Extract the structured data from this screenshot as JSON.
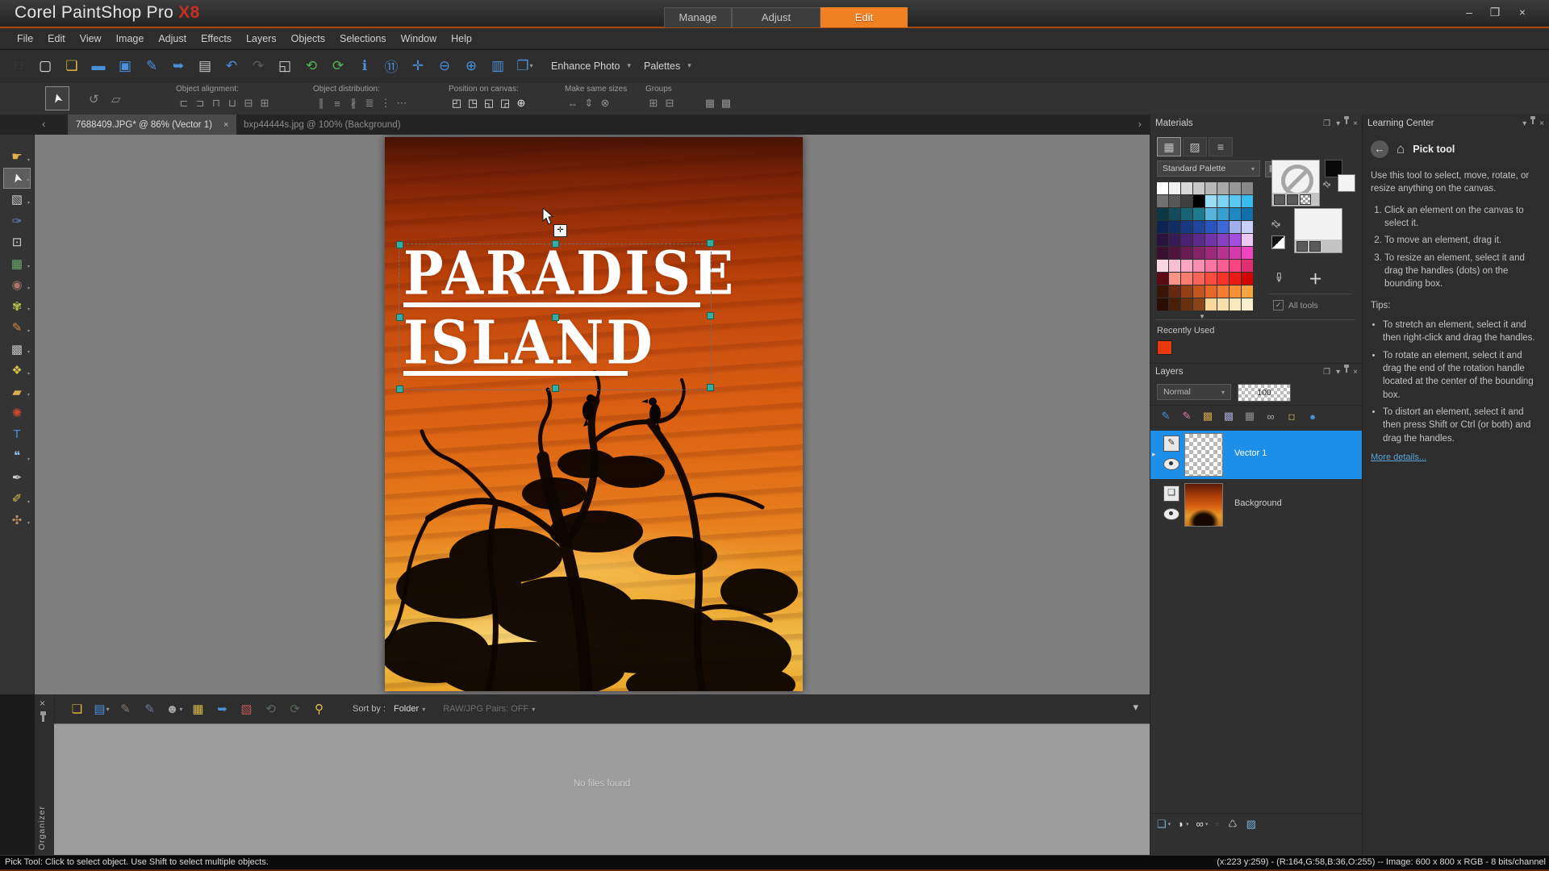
{
  "window": {
    "title": "Corel PaintShop Pro ",
    "title_suffix": "X8",
    "minimize": "–",
    "restore": "❐",
    "close": "×"
  },
  "workspace_tabs": [
    {
      "label": "Manage",
      "active": false
    },
    {
      "label": "Adjust",
      "active": false
    },
    {
      "label": "Edit",
      "active": true
    }
  ],
  "menu": {
    "items": [
      "File",
      "Edit",
      "View",
      "Image",
      "Adjust",
      "Effects",
      "Layers",
      "Objects",
      "Selections",
      "Window",
      "Help"
    ]
  },
  "toolbar": {
    "buttons": [
      {
        "name": "new-file-button",
        "glyph": "▢",
        "color": "#e8e8e8"
      },
      {
        "name": "open-button",
        "glyph": "❏",
        "color": "#e8b63a"
      },
      {
        "name": "express-lab-button",
        "glyph": "▬",
        "color": "#4a90d8"
      },
      {
        "name": "save-button",
        "glyph": "▣",
        "color": "#4a90d8"
      },
      {
        "name": "save-as-button",
        "glyph": "✎",
        "color": "#4a90d8"
      },
      {
        "name": "share-button",
        "glyph": "➥",
        "color": "#4a90d8"
      },
      {
        "name": "print-button",
        "glyph": "▤",
        "color": "#c8c8c8"
      },
      {
        "name": "undo-button",
        "glyph": "↶",
        "color": "#4a90d8"
      },
      {
        "name": "redo-button",
        "glyph": "↷",
        "color": "#5e5e5e"
      },
      {
        "name": "resize-button",
        "glyph": "◱",
        "color": "#d8d8d8"
      },
      {
        "name": "rotate-left-button",
        "glyph": "⟲",
        "color": "#58b058"
      },
      {
        "name": "rotate-right-button",
        "glyph": "⟳",
        "color": "#58b058"
      },
      {
        "name": "image-info-button",
        "glyph": "ℹ",
        "color": "#4a90d8"
      },
      {
        "name": "calendar-button",
        "glyph": "⑪",
        "color": "#4a90d8"
      },
      {
        "name": "fit-window-button",
        "glyph": "✛",
        "color": "#4a90d8"
      },
      {
        "name": "zoom-out-button",
        "glyph": "⊖",
        "color": "#4a90d8"
      },
      {
        "name": "zoom-in-button",
        "glyph": "⊕",
        "color": "#4a90d8"
      },
      {
        "name": "screen-preview-button",
        "glyph": "▥",
        "color": "#4a90d8"
      },
      {
        "name": "copy-button",
        "glyph": "❐",
        "color": "#4a90d8",
        "dd": "▾"
      }
    ],
    "enhance_label": "Enhance Photo",
    "palettes_label": "Palettes",
    "dropdown_glyph": "▾"
  },
  "options_bar": {
    "transform_icons": [
      "↺",
      "▱"
    ],
    "groups": [
      {
        "label": "Object alignment:",
        "icons": [
          "⊏",
          "⊐",
          "⊓",
          "⊔",
          "⊟",
          "⊞"
        ]
      },
      {
        "label": "Object distribution:",
        "icons": [
          "∥",
          "≡",
          "∦",
          "≣",
          "⋮",
          "⋯"
        ]
      },
      {
        "label": "Position on canvas:",
        "icons": [
          "◰",
          "◳",
          "◱",
          "◲",
          "⊕"
        ]
      },
      {
        "label": "Make same sizes",
        "icons": [
          "⇔",
          "⇕",
          "⊗"
        ]
      },
      {
        "label": "Groups",
        "icons": [
          "⊞",
          "⊟"
        ]
      },
      {
        "label": "",
        "icons": [
          "▦",
          "▩"
        ]
      }
    ]
  },
  "document_tabs": {
    "prev": "‹",
    "next": "›",
    "tabs": [
      {
        "label": "7688409.JPG* @ 86% (Vector 1)",
        "close": "×",
        "active": true
      },
      {
        "label": "bxp44444s.jpg @ 100% (Background)",
        "active": false
      }
    ]
  },
  "tools": [
    {
      "name": "pan-tool",
      "glyph": "☛",
      "color": "#e2b14a",
      "dd": "▾",
      "state": ""
    },
    {
      "name": "pick-tool",
      "glyph": "➤",
      "color": "#f0f0f0",
      "dd": "▾",
      "state": "selected"
    },
    {
      "name": "selection-tool",
      "glyph": "▧",
      "color": "#c8c8c8",
      "dd": "▾",
      "state": ""
    },
    {
      "name": "dropper-tool",
      "glyph": "✑",
      "color": "#6a86c8",
      "state": ""
    },
    {
      "name": "crop-tool",
      "glyph": "⊡",
      "color": "#d0d0d0",
      "state": ""
    },
    {
      "name": "straighten-tool",
      "glyph": "▦",
      "color": "#6aa86a",
      "dd": "▾",
      "state": ""
    },
    {
      "name": "red-eye-tool",
      "glyph": "◉",
      "color": "#a87868",
      "dd": "▾",
      "state": ""
    },
    {
      "name": "makeover-tool",
      "glyph": "✾",
      "color": "#b8c050",
      "dd": "▾",
      "state": ""
    },
    {
      "name": "paint-brush-tool",
      "glyph": "✎",
      "color": "#d08840",
      "dd": "▾",
      "state": ""
    },
    {
      "name": "flood-fill-tool",
      "glyph": "▩",
      "color": "#c0c0c0",
      "dd": "▾",
      "state": ""
    },
    {
      "name": "picture-tube-tool",
      "glyph": "❖",
      "color": "#d8c050",
      "dd": "▾",
      "state": ""
    },
    {
      "name": "eraser-tool",
      "glyph": "▰",
      "color": "#d8b050",
      "dd": "▾",
      "state": ""
    },
    {
      "name": "airbrush-tool",
      "glyph": "✺",
      "color": "#d04830",
      "state": ""
    },
    {
      "name": "text-tool",
      "glyph": "T",
      "color": "#4a90d8",
      "state": ""
    },
    {
      "name": "preset-shapes-tool",
      "glyph": "❝",
      "color": "#88c0e8",
      "dd": "▾",
      "state": ""
    },
    {
      "name": "pen-tool",
      "glyph": "✒",
      "color": "#cccccc",
      "state": ""
    },
    {
      "name": "warp-brush-tool",
      "glyph": "✐",
      "color": "#d8c050",
      "dd": "▾",
      "state": ""
    },
    {
      "name": "smudge-brush-tool",
      "glyph": "✣",
      "color": "#c09060",
      "dd": "▾",
      "state": ""
    }
  ],
  "canvas": {
    "doc_text_line1": "PARADISE",
    "doc_text_line2": "ISLAND",
    "move_glyph": "✛"
  },
  "materials": {
    "title": "Materials",
    "float_glyph": "❐",
    "menu_glyph": "▾",
    "close_glyph": "×",
    "tab_swatches": "▦",
    "tab_frame": "▨",
    "tab_sliders": "≡",
    "palette_label": "Standard Palette",
    "swatches": [
      "#ffffff",
      "#f2f2f2",
      "#d8d8d8",
      "#c8c8c8",
      "#b8b8b8",
      "#a8a8a8",
      "#989898",
      "#888888",
      "#707070",
      "#585858",
      "#404040",
      "#000000",
      "#9adcf4",
      "#7cd2f2",
      "#5ac8f0",
      "#38bcee",
      "#0c3844",
      "#124c5a",
      "#186274",
      "#1e7a8e",
      "#5ab4da",
      "#38a0d0",
      "#2088c0",
      "#1070ac",
      "#0e2450",
      "#122c64",
      "#183880",
      "#1e449c",
      "#2a54bc",
      "#3c68d8",
      "#a0b0ec",
      "#c6d0f8",
      "#28123e",
      "#381a56",
      "#4a2270",
      "#5c2a8a",
      "#7034a6",
      "#8840c2",
      "#a44ede",
      "#eec6f6",
      "#3a1030",
      "#501640",
      "#681c54",
      "#822268",
      "#9c2a7c",
      "#b83292",
      "#d43aa8",
      "#f044be",
      "#f8d6e2",
      "#f8bed2",
      "#f8a6c2",
      "#f88eb2",
      "#f876a2",
      "#f85e92",
      "#f84682",
      "#e42e72",
      "#5a0a16",
      "#f89488",
      "#f87c70",
      "#f86458",
      "#f84c40",
      "#f83428",
      "#e81c14",
      "#d40404",
      "#3a1406",
      "#66280e",
      "#944016",
      "#c2541e",
      "#e66826",
      "#f87c2e",
      "#f89036",
      "#f8a43e",
      "#280e04",
      "#48200a",
      "#683210",
      "#884416",
      "#f8d89c",
      "#f8e0ac",
      "#f8e8bc",
      "#f8f0cc"
    ],
    "more_glyph": "▼",
    "swap_glyph": "⇄",
    "dropper_glyph": "✑",
    "plus_glyph": "＋",
    "check_glyph": "✓",
    "all_tools_label": "All tools",
    "recently_used_label": "Recently Used",
    "recent_color": "#e8380d"
  },
  "layers": {
    "title": "Layers",
    "float_glyph": "❐",
    "menu_glyph": "▾",
    "close_glyph": "×",
    "blend_mode": "Normal",
    "opacity": "100",
    "toolbar": [
      {
        "name": "new-raster-layer-button",
        "glyph": "✎",
        "color": "#4a90d8"
      },
      {
        "name": "new-art-media-layer-button",
        "glyph": "✎",
        "color": "#d87ab0"
      },
      {
        "name": "new-vector-layer-button",
        "glyph": "▩",
        "color": "#c8a050"
      },
      {
        "name": "new-group-layer-button",
        "glyph": "▩",
        "color": "#a0a0c8"
      },
      {
        "name": "new-mask-layer-button",
        "glyph": "▦",
        "color": "#8f8f8f"
      },
      {
        "name": "link-layers-button",
        "glyph": "∞",
        "color": "#b0b0b0"
      },
      {
        "name": "lock-transparency-button",
        "glyph": "◘",
        "color": "#8a7a50"
      },
      {
        "name": "highlight-layer-button",
        "glyph": "●",
        "color": "#4a90d8"
      }
    ],
    "expand_glyph": "▸",
    "items": [
      {
        "name": "Vector 1",
        "type_glyph": "✎",
        "active": true
      },
      {
        "name": "Background",
        "type_glyph": "❏",
        "active": false
      }
    ],
    "bottom_toolbar": [
      {
        "name": "new-layer-button",
        "glyph": "❏",
        "color": "#7ab0d8",
        "dd": "▾"
      },
      {
        "name": "new-mask-button",
        "glyph": "◗",
        "color": "#e0e0e0",
        "dd": "▾"
      },
      {
        "name": "new-adjustment-layer-button",
        "glyph": "∞",
        "color": "#e0e0e0",
        "dd": "▾"
      },
      {
        "name": "edit-selection-button",
        "glyph": "▫",
        "color": "#5e5e5e"
      },
      {
        "name": "delete-layer-button",
        "glyph": "♺",
        "color": "#b0b0b0"
      },
      {
        "name": "layer-composite-button",
        "glyph": "▨",
        "color": "#7ab0d8"
      }
    ]
  },
  "learning_center": {
    "title": "Learning Center",
    "menu_glyph": "▾",
    "close_glyph": "×",
    "back_glyph": "←",
    "home_glyph": "⌂",
    "heading": "Pick tool",
    "intro": "Use this tool to select, move, rotate, or resize anything on the canvas.",
    "steps": [
      "Click an element on the canvas to select it.",
      "To move an element, drag it.",
      "To resize an element, select it and drag the handles (dots) on the bounding box."
    ],
    "tips_label": "Tips:",
    "tips": [
      "To stretch an element, select it and then right-click and drag the handles.",
      "To rotate an element, select it and drag the end of the rotation handle located at the center of the bounding box.",
      "To distort an element, select it and then press Shift or Ctrl (or both) and drag the handles."
    ],
    "link": "More details..."
  },
  "organizer": {
    "close_glyph": "×",
    "vertical_label": "Organizer",
    "buttons": [
      {
        "name": "folder-tree-button",
        "glyph": "❏",
        "color": "#e8b63a"
      },
      {
        "name": "thumbnail-info-button",
        "glyph": "▤",
        "color": "#4a90d8",
        "dd": "▾"
      },
      {
        "name": "quick-tag-button",
        "glyph": "✎",
        "color": "#8a7a6a"
      },
      {
        "name": "quick-rating-button",
        "glyph": "✎",
        "color": "#6a7a9a"
      },
      {
        "name": "people-tag-button",
        "glyph": "☻",
        "color": "#a8a8a8",
        "dd": "▾"
      },
      {
        "name": "map-location-button",
        "glyph": "▦",
        "color": "#d8b84a"
      },
      {
        "name": "share-button",
        "glyph": "➥",
        "color": "#4a90d8"
      },
      {
        "name": "slideshow-button",
        "glyph": "▧",
        "color": "#c05858"
      },
      {
        "name": "rotate-left-button",
        "glyph": "⟲",
        "color": "#5a6a5a"
      },
      {
        "name": "rotate-right-button",
        "glyph": "⟳",
        "color": "#5a6a5a"
      },
      {
        "name": "find-photos-button",
        "glyph": "⚲",
        "color": "#e8c04a"
      }
    ],
    "sort_label": "Sort by :",
    "sort_value": "Folder",
    "raw_label": "RAW/JPG Pairs: OFF",
    "dropdown_glyph": "▾",
    "collapse_glyph": "▾",
    "empty_text": "No files found"
  },
  "status_bar": {
    "left": "Pick Tool: Click to select object. Use Shift to select multiple objects.",
    "right": "(x:223 y:259) - (R:164,G:58,B:36,O:255) -- Image: 600 x 800 x RGB - 8 bits/channel"
  },
  "colors": {
    "accent": "#ef8122",
    "selection_blue": "#1e8fe8",
    "handle_teal": "#35aca2"
  }
}
